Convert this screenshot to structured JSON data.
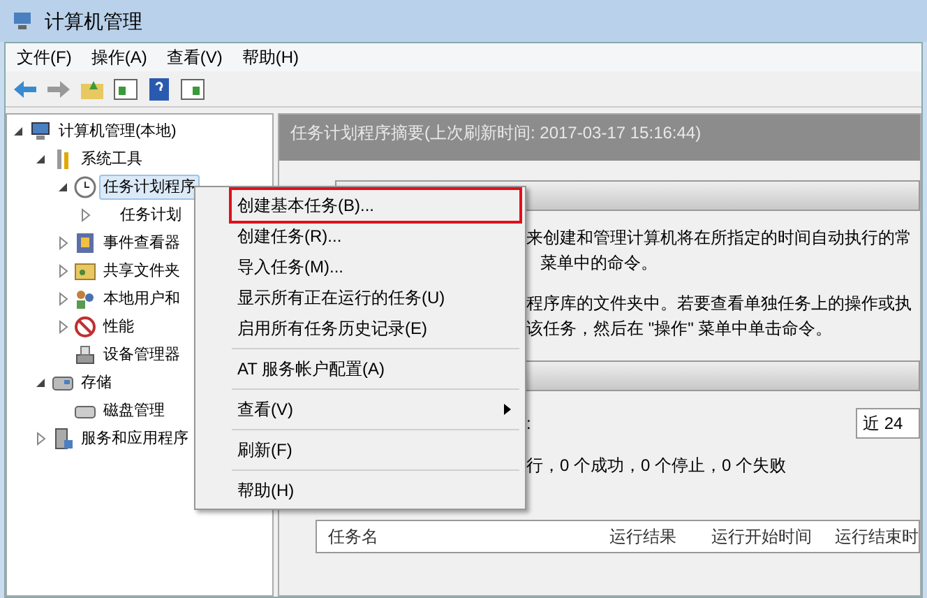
{
  "window": {
    "title": "计算机管理"
  },
  "menu_bar": [
    "文件(F)",
    "操作(A)",
    "查看(V)",
    "帮助(H)"
  ],
  "tree": [
    {
      "label": "计算机管理(本地)",
      "kind": "computer",
      "expanded": true,
      "children": [
        {
          "label": "系统工具",
          "kind": "tools",
          "expanded": true,
          "children": [
            {
              "label": "任务计划程序",
              "kind": "clock",
              "expanded": true,
              "selected": true,
              "children": [
                {
                  "label": "任务计划",
                  "expanded": false,
                  "selected": false
                }
              ]
            },
            {
              "label": "事件查看器",
              "kind": "event",
              "expanded": false,
              "selected": false
            },
            {
              "label": "共享文件夹",
              "kind": "folder",
              "expanded": false,
              "selected": false
            },
            {
              "label": "本地用户和",
              "kind": "users",
              "expanded": false,
              "selected": false
            },
            {
              "label": "性能",
              "kind": "perf",
              "expanded": false,
              "selected": false
            },
            {
              "label": "设备管理器",
              "kind": "device",
              "selected": false
            }
          ]
        },
        {
          "label": "存储",
          "kind": "storage",
          "expanded": true,
          "children": [
            {
              "label": "磁盘管理",
              "kind": "disk",
              "selected": false
            }
          ]
        },
        {
          "label": "服务和应用程序",
          "kind": "server",
          "expanded": false
        }
      ]
    }
  ],
  "summary_header": "任务计划程序摘要(上次刷新时间: 2017-03-17 15:16:44)",
  "overview_lines": [
    "来创建和管理计算机将在所指定的时间自动执行的常",
    "菜单中的命令。",
    "程序库的文件夹中。若要查看单独任务上的操作或执",
    "该任务，然后在 \"操作\" 菜单中单击命令。"
  ],
  "status_label": ":",
  "period_select": "近 24",
  "status_counts": "行，0 个成功，0 个停止，0 个失败",
  "table_columns": [
    "任务名",
    "运行结果",
    "运行开始时间",
    "运行结束时"
  ],
  "context_menu": [
    {
      "kind": "item",
      "label": "创建基本任务(B)...",
      "highlighted": true
    },
    {
      "kind": "item",
      "label": "创建任务(R)...",
      "highlighted": false
    },
    {
      "kind": "item",
      "label": "导入任务(M)...",
      "highlighted": false
    },
    {
      "kind": "item",
      "label": "显示所有正在运行的任务(U)",
      "highlighted": false
    },
    {
      "kind": "item",
      "label": "启用所有任务历史记录(E)",
      "highlighted": false
    },
    {
      "kind": "separator"
    },
    {
      "kind": "item",
      "label": "AT 服务帐户配置(A)",
      "highlighted": false
    },
    {
      "kind": "separator"
    },
    {
      "kind": "submenu",
      "label": "查看(V)",
      "highlighted": false
    },
    {
      "kind": "separator"
    },
    {
      "kind": "item",
      "label": "刷新(F)",
      "highlighted": false
    },
    {
      "kind": "separator"
    },
    {
      "kind": "item",
      "label": "帮助(H)",
      "highlighted": false
    }
  ]
}
